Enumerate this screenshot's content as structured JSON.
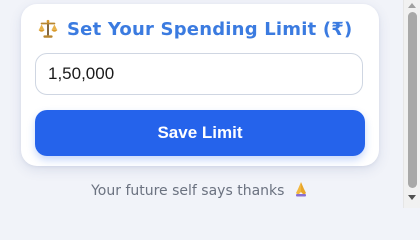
{
  "card": {
    "title": "Set Your Spending Limit (₹)",
    "title_icon": "scale-icon",
    "limit_input": {
      "value": "1,50,000",
      "placeholder": ""
    },
    "save_label": "Save Limit"
  },
  "footer": {
    "text": "Your future self says thanks",
    "icon": "praying-hands-icon"
  },
  "colors": {
    "accent": "#3b7be0",
    "button": "#2563eb",
    "background": "#f1f3f9"
  }
}
